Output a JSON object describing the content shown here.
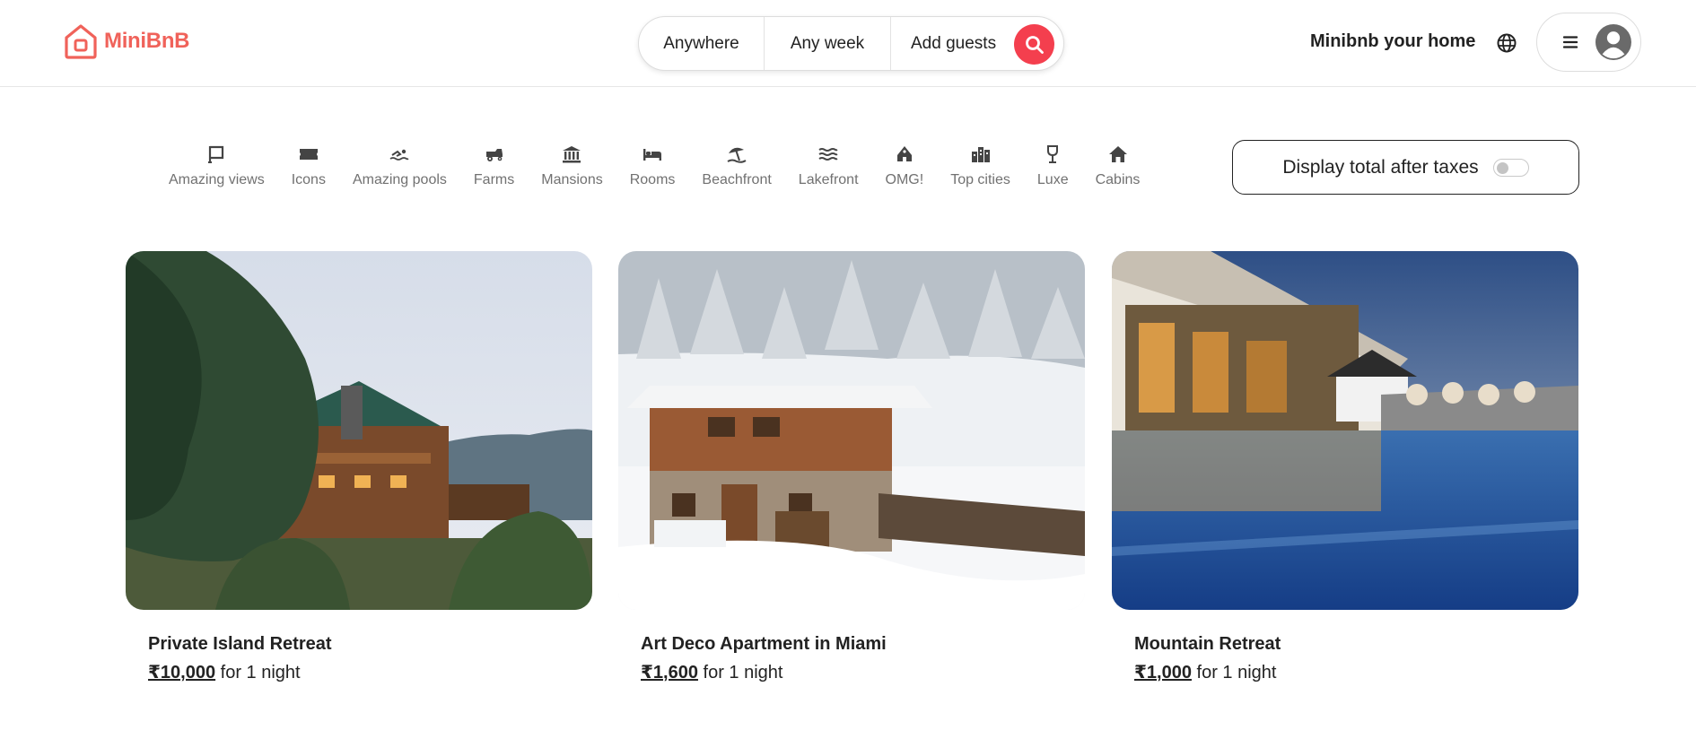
{
  "brand": {
    "name": "MiniBnB",
    "color": "#f0625a"
  },
  "search": {
    "location_label": "Anywhere",
    "dates_label": "Any week",
    "guests_label": "Add guests",
    "button_icon": "search-icon",
    "accent": "#f43f4e"
  },
  "header": {
    "host_label": "Minibnb your home",
    "language_icon": "globe-icon",
    "menu_icon": "hamburger-icon",
    "avatar_icon": "user-avatar-icon"
  },
  "categories": [
    {
      "label": "Amazing views",
      "icon": "flag-frame-icon"
    },
    {
      "label": "Icons",
      "icon": "ticket-icon"
    },
    {
      "label": "Amazing pools",
      "icon": "swimmer-icon"
    },
    {
      "label": "Farms",
      "icon": "tractor-icon"
    },
    {
      "label": "Mansions",
      "icon": "column-building-icon"
    },
    {
      "label": "Rooms",
      "icon": "bed-icon"
    },
    {
      "label": "Beachfront",
      "icon": "beach-umbrella-icon"
    },
    {
      "label": "Lakefront",
      "icon": "waves-icon"
    },
    {
      "label": "OMG!",
      "icon": "ufo-house-icon"
    },
    {
      "label": "Top cities",
      "icon": "city-skyline-icon"
    },
    {
      "label": "Luxe",
      "icon": "wine-glass-icon"
    },
    {
      "label": "Cabins",
      "icon": "house-icon"
    }
  ],
  "taxes": {
    "label": "Display total after taxes",
    "enabled": false
  },
  "listings": [
    {
      "title": "Private Island Retreat",
      "price": "₹10,000",
      "suffix": "for 1 night",
      "image": "log-lodge-photo"
    },
    {
      "title": "Art Deco Apartment in Miami",
      "price": "₹1,600",
      "suffix": "for 1 night",
      "image": "snowy-chalet-photo"
    },
    {
      "title": "Mountain Retreat",
      "price": "₹1,000",
      "suffix": "for 1 night",
      "image": "resort-pool-photo"
    }
  ]
}
